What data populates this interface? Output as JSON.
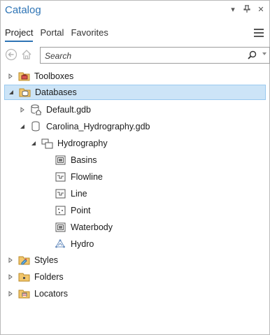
{
  "pane": {
    "title": "Catalog",
    "window_controls": [
      "pin-menu-icon",
      "pin-icon",
      "close-icon"
    ]
  },
  "tabs": [
    {
      "label": "Project",
      "active": true
    },
    {
      "label": "Portal",
      "active": false
    },
    {
      "label": "Favorites",
      "active": false
    }
  ],
  "search": {
    "placeholder": "Search",
    "value": ""
  },
  "tree": [
    {
      "label": "Toolboxes",
      "icon": "toolbox-icon",
      "expander": "collapsed"
    },
    {
      "label": "Databases",
      "icon": "database-folder-icon",
      "expander": "expanded",
      "selected": true
    },
    {
      "label": "Default.gdb",
      "icon": "geodatabase-home-icon",
      "expander": "collapsed"
    },
    {
      "label": "Carolina_Hydrography.gdb",
      "icon": "geodatabase-icon",
      "expander": "expanded"
    },
    {
      "label": "Hydrography",
      "icon": "feature-dataset-icon",
      "expander": "expanded"
    },
    {
      "label": "Basins",
      "icon": "polygon-feature-class-icon",
      "expander": "none"
    },
    {
      "label": "Flowline",
      "icon": "line-feature-class-icon",
      "expander": "none"
    },
    {
      "label": "Line",
      "icon": "line-feature-class-icon",
      "expander": "none"
    },
    {
      "label": "Point",
      "icon": "point-feature-class-icon",
      "expander": "none"
    },
    {
      "label": "Waterbody",
      "icon": "polygon-feature-class-icon",
      "expander": "none"
    },
    {
      "label": "Hydro",
      "icon": "geometric-network-icon",
      "expander": "none"
    },
    {
      "label": "Styles",
      "icon": "styles-folder-icon",
      "expander": "collapsed"
    },
    {
      "label": "Folders",
      "icon": "folder-icon",
      "expander": "collapsed"
    },
    {
      "label": "Locators",
      "icon": "locator-folder-icon",
      "expander": "collapsed"
    }
  ]
}
